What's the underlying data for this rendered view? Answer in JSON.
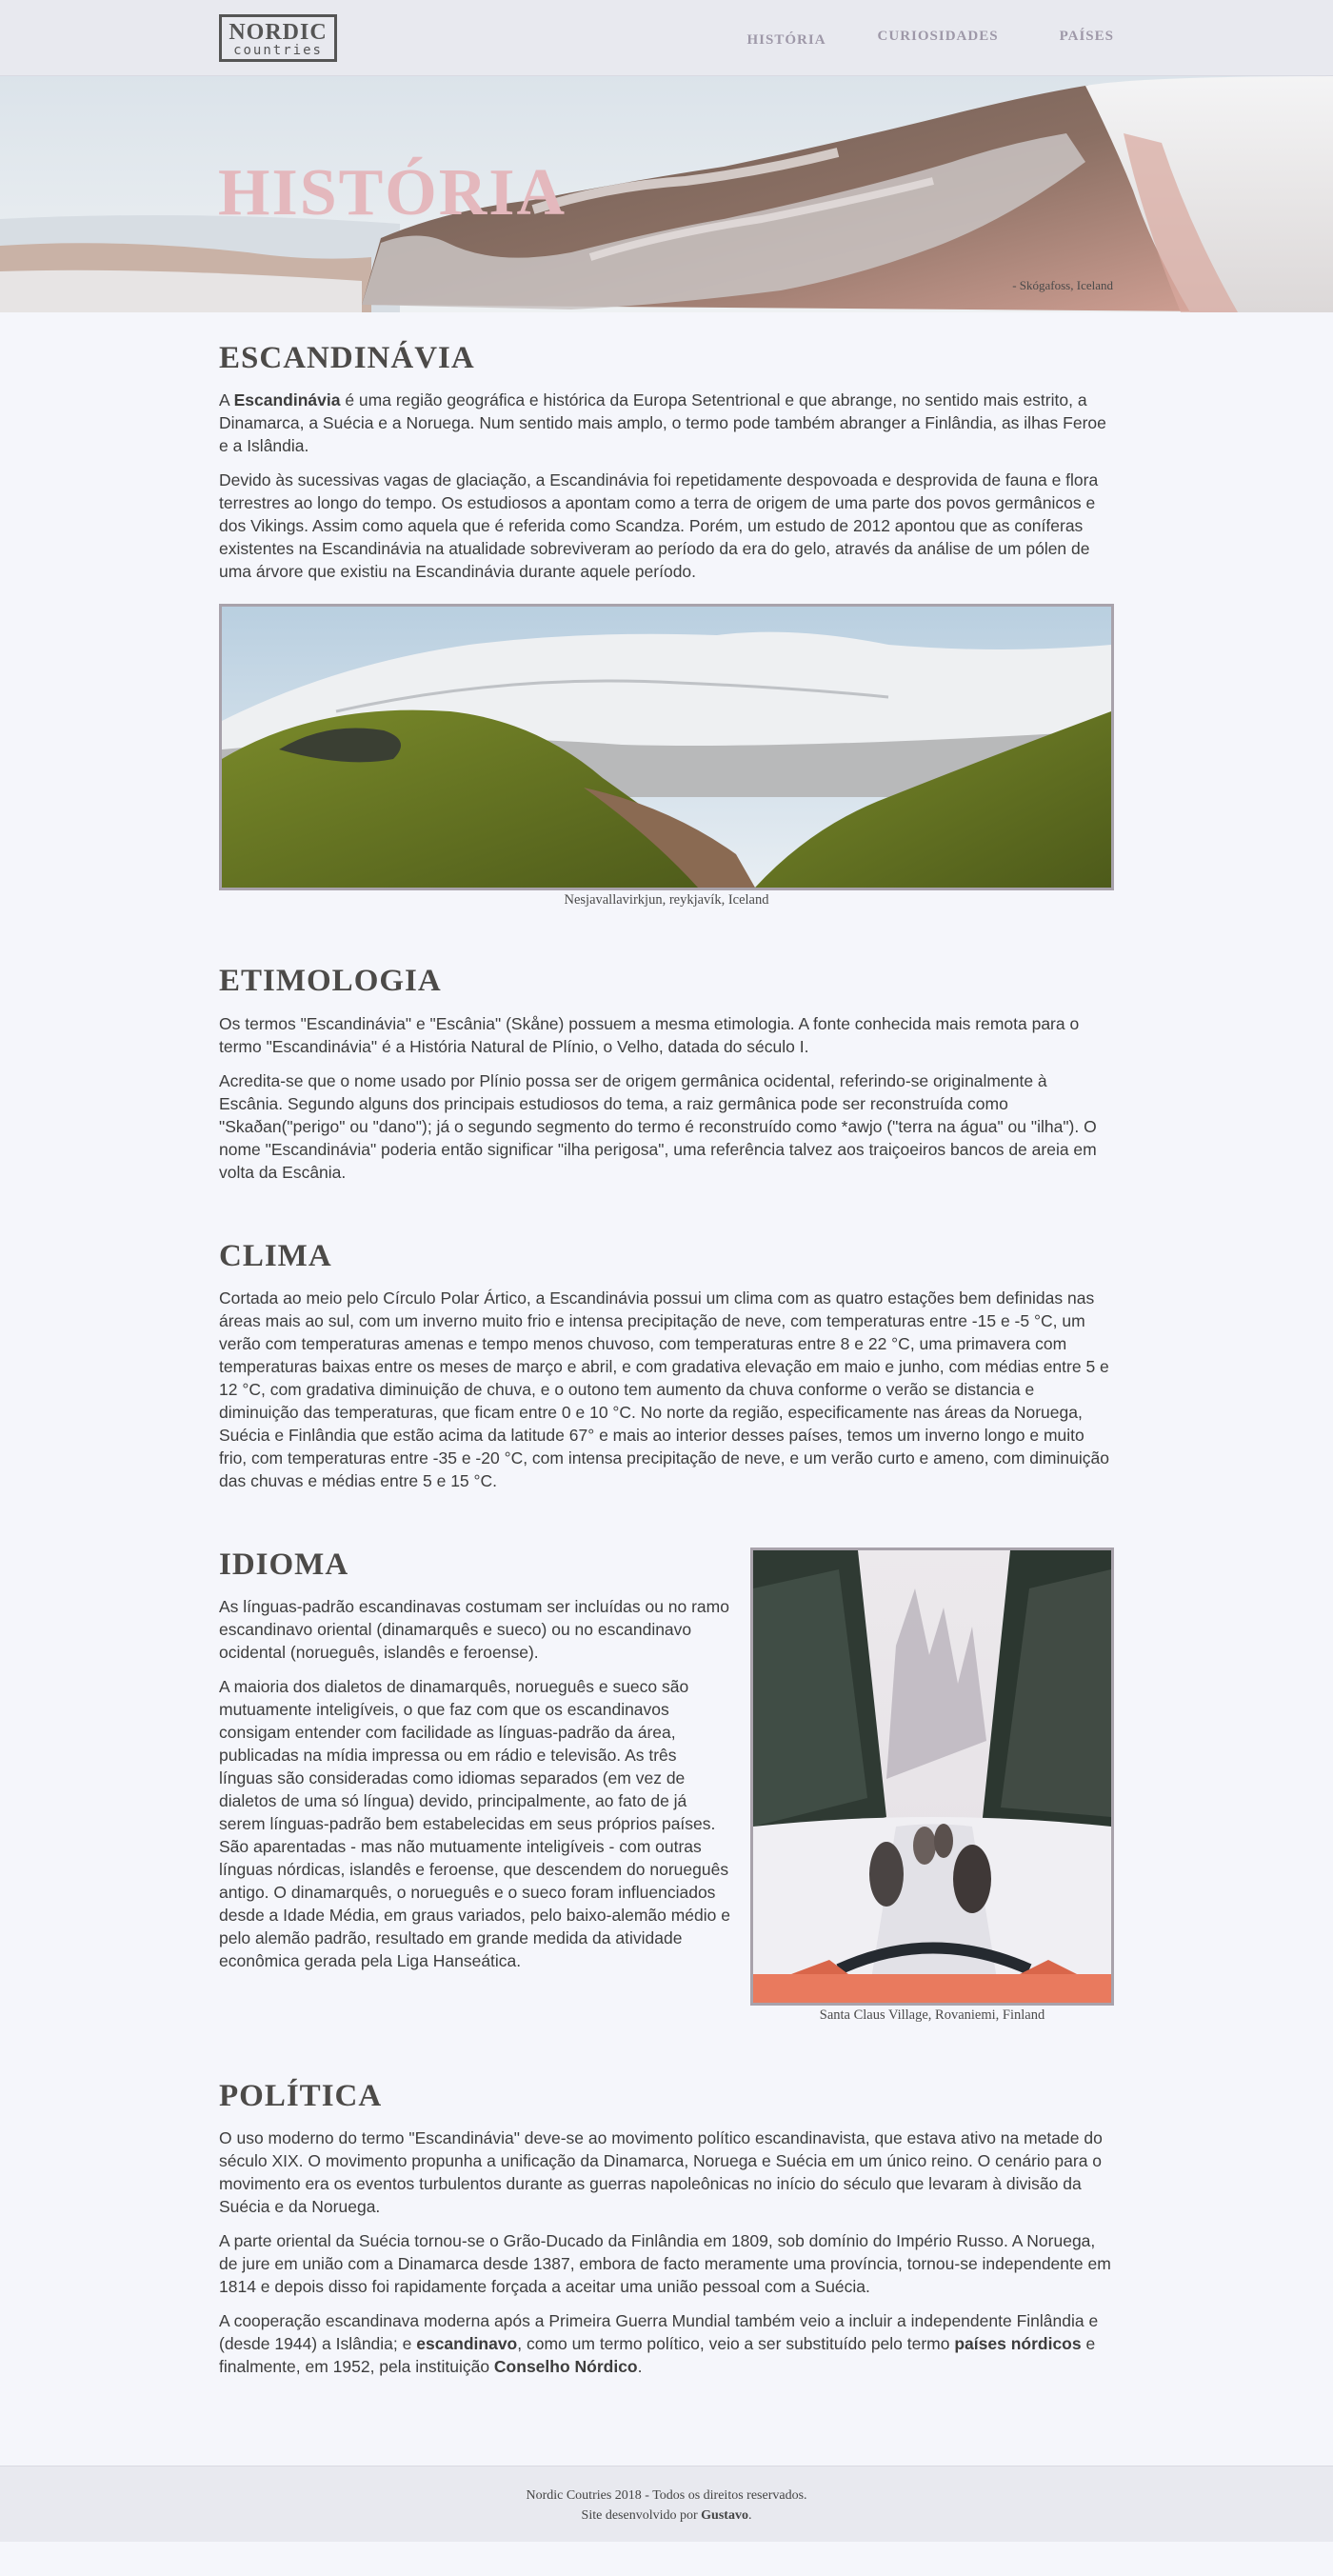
{
  "header": {
    "logo_top": "NORDIC",
    "logo_bottom": "countries",
    "nav": [
      "HISTÓRIA",
      "CURIOSIDADES",
      "PAÍSES"
    ]
  },
  "hero": {
    "title": "HISTÓRIA",
    "caption": "- Skógafoss, Iceland"
  },
  "sections": {
    "escandinavia": {
      "title": "ESCANDINÁVIA",
      "p1_bold": "Escandinávia",
      "p1_prefix": "A ",
      "p1_rest": " é uma região geográfica e histórica da Europa Setentrional e que abrange, no sentido mais estrito, a Dinamarca, a Suécia e a Noruega. Num sentido mais amplo, o termo pode também abranger a Finlândia, as ilhas Feroe e a Islândia.",
      "p2": "Devido às sucessivas vagas de glaciação, a Escandinávia foi repetidamente despovoada e desprovida de fauna e flora terrestres ao longo do tempo. Os estudiosos a apontam como a terra de origem de uma parte dos povos germânicos e dos Vikings. Assim como aquela que é referida como Scandza. Porém, um estudo de 2012 apontou que as coníferas existentes na Escandinávia na atualidade sobreviveram ao período da era do gelo, através da análise de um pólen de uma árvore que existiu na Escandinávia durante aquele período.",
      "caption": "Nesjavallavirkjun, reykjavík, Iceland"
    },
    "etimologia": {
      "title": "ETIMOLOGIA",
      "p1": "Os termos \"Escandinávia\" e \"Escânia\" (Skåne) possuem a mesma etimologia. A fonte conhecida mais remota para o termo \"Escandinávia\" é a História Natural de Plínio, o Velho, datada do século I.",
      "p2": "Acredita-se que o nome usado por Plínio possa ser de origem germânica ocidental, referindo-se originalmente à Escânia. Segundo alguns dos principais estudiosos do tema, a raiz germânica pode ser reconstruída como \"Skaðan(\"perigo\" ou \"dano\"); já o segundo segmento do termo é reconstruído como *awjo (\"terra na água\" ou \"ilha\"). O nome \"Escandinávia\" poderia então significar \"ilha perigosa\", uma referência talvez aos traiçoeiros bancos de areia em volta da Escânia."
    },
    "clima": {
      "title": "CLIMA",
      "p1": "Cortada ao meio pelo Círculo Polar Ártico, a Escandinávia possui um clima com as quatro estações bem definidas nas áreas mais ao sul, com um inverno muito frio e intensa precipitação de neve, com temperaturas entre -15 e -5 °C, um verão com temperaturas amenas e tempo menos chuvoso, com temperaturas entre 8 e 22 °C, uma primavera com temperaturas baixas entre os meses de março e abril, e com gradativa elevação em maio e junho, com médias entre 5 e 12 °C, com gradativa diminuição de chuva, e o outono tem aumento da chuva conforme o verão se distancia e diminuição das temperaturas, que ficam entre 0 e 10 °C. No norte da região, especificamente nas áreas da Noruega, Suécia e Finlândia que estão acima da latitude 67° e mais ao interior desses países, temos um inverno longo e muito frio, com temperaturas entre -35 e -20 °C, com intensa precipitação de neve, e um verão curto e ameno, com diminuição das chuvas e médias entre 5 e 15 °C."
    },
    "idioma": {
      "title": "IDIOMA",
      "p1": "As línguas-padrão escandinavas costumam ser incluídas ou no ramo escandinavo oriental (dinamarquês e sueco) ou no escandinavo ocidental (norueguês, islandês e feroense).",
      "p2": "A maioria dos dialetos de dinamarquês, norueguês e sueco são mutuamente inteligíveis, o que faz com que os escandinavos consigam entender com facilidade as línguas-padrão da área, publicadas na mídia impressa ou em rádio e televisão. As três línguas são consideradas como idiomas separados (em vez de dialetos de uma só língua) devido, principalmente, ao fato de já serem línguas-padrão bem estabelecidas em seus próprios países. São aparentadas - mas não mutuamente inteligíveis - com outras línguas nórdicas, islandês e feroense, que descendem do norueguês antigo. O dinamarquês, o norueguês e o sueco foram influenciados desde a Idade Média, em graus variados, pelo baixo-alemão médio e pelo alemão padrão, resultado em grande medida da atividade econômica gerada pela Liga Hanseática.",
      "caption": "Santa Claus Village, Rovaniemi, Finland"
    },
    "politica": {
      "title": "POLÍTICA",
      "p1": "O uso moderno do termo \"Escandinávia\" deve-se ao movimento político escandinavista, que estava ativo na metade do século XIX. O movimento propunha a unificação da Dinamarca, Noruega e Suécia em um único reino. O cenário para o movimento era os eventos turbulentos durante as guerras napoleônicas no início do século que levaram à divisão da Suécia e da Noruega.",
      "p2": "A parte oriental da Suécia tornou-se o Grão-Ducado da Finlândia em 1809, sob domínio do Império Russo. A Noruega, de jure em união com a Dinamarca desde 1387, embora de facto meramente uma província, tornou-se independente em 1814 e depois disso foi rapidamente forçada a aceitar uma união pessoal com a Suécia.",
      "p3_a": "A cooperação escandinava moderna após a Primeira Guerra Mundial também veio a incluir a independente Finlândia e (desde 1944) a Islândia; e ",
      "p3_b1": "escandinavo",
      "p3_c": ", como um termo político, veio a ser substituído pelo termo ",
      "p3_b2": "países nórdicos",
      "p3_d": " e finalmente, em 1952, pela instituição ",
      "p3_b3": "Conselho Nórdico",
      "p3_e": "."
    }
  },
  "footer": {
    "line1": "Nordic Coutries 2018 - Todos os direitos reservados.",
    "line2_prefix": "Site desenvolvido por ",
    "line2_bold": "Gustavo",
    "line2_suffix": "."
  },
  "colors": {
    "background": "#f5f6fb",
    "header_bg": "#e8e9ef",
    "hero_title": "#e4b8bd",
    "nav_text": "#9e98a8",
    "heading": "#4c4a48"
  }
}
